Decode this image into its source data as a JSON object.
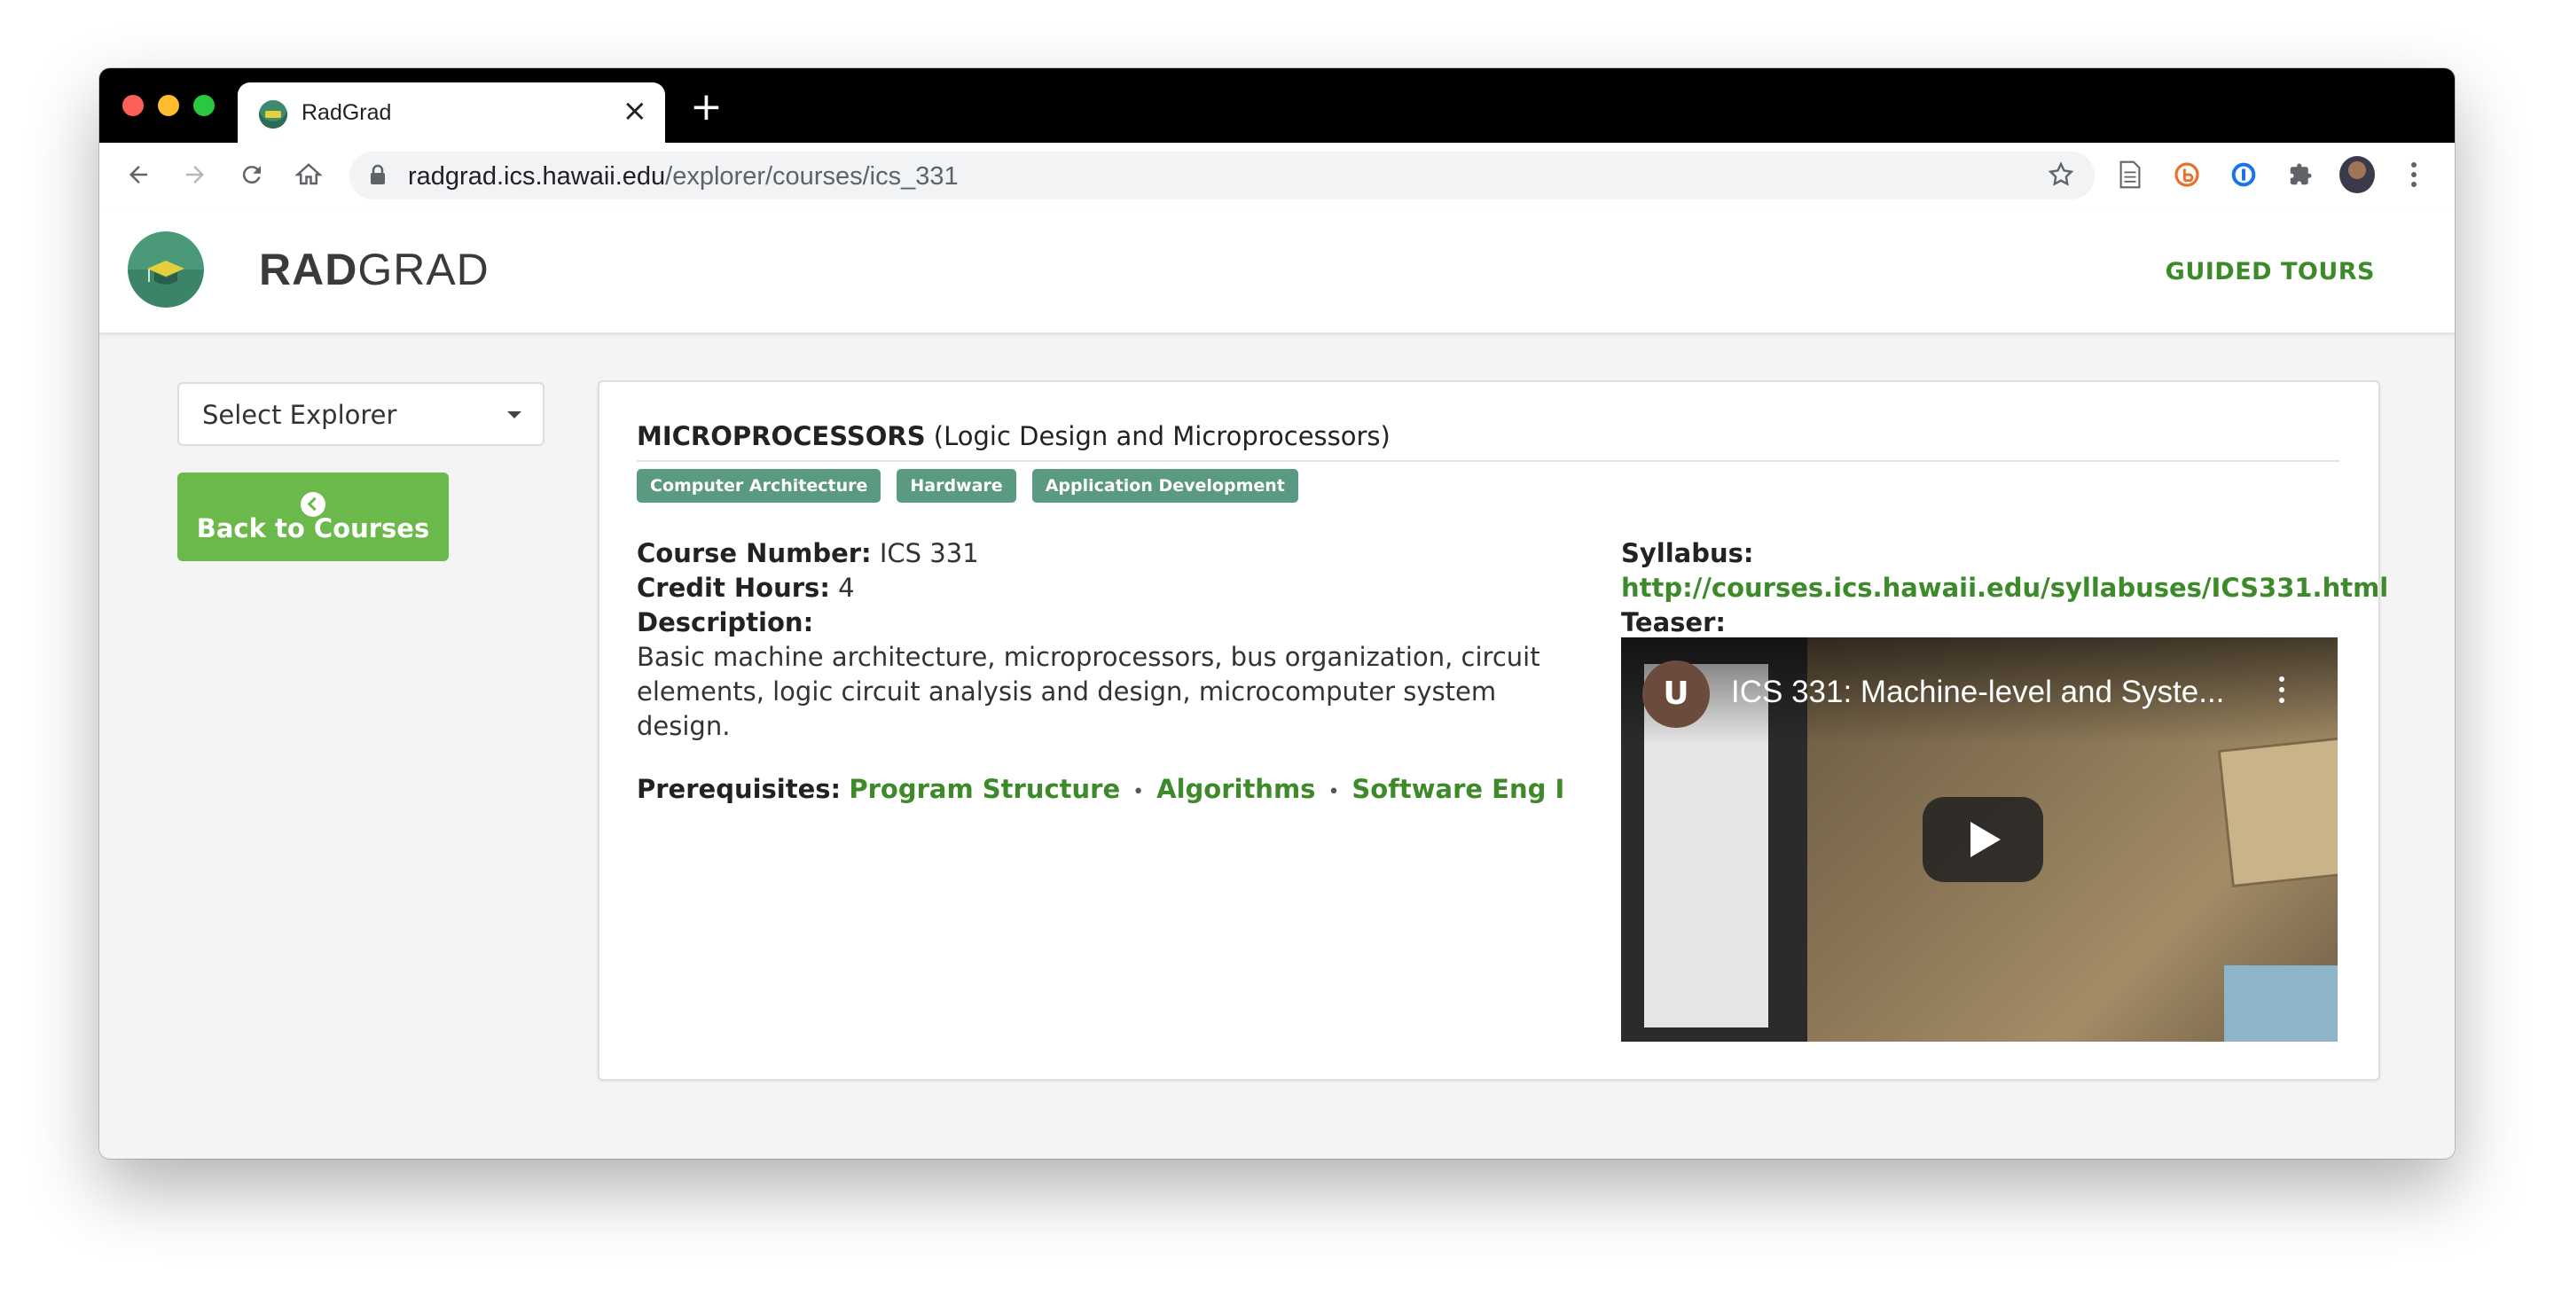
{
  "browser": {
    "tab_title": "RadGrad",
    "tab_close": "×",
    "new_tab": "+",
    "url_host": "radgrad.ics.hawaii.edu",
    "url_path": "/explorer/courses/ics_331"
  },
  "header": {
    "brand_bold": "RAD",
    "brand_light": "GRAD",
    "guided_tours": "GUIDED TOURS"
  },
  "sidebar": {
    "select_label": "Select Explorer",
    "back_button": "Back to Courses"
  },
  "course": {
    "title_main": "MICROPROCESSORS",
    "title_sub": " (Logic Design and Microprocessors)",
    "tags": [
      "Computer Architecture",
      "Hardware",
      "Application Development"
    ],
    "course_number_label": "Course Number:",
    "course_number": "ICS 331",
    "credit_hours_label": "Credit Hours:",
    "credit_hours": "4",
    "description_label": "Description:",
    "description": "Basic machine architecture, microprocessors, bus organization, circuit elements, logic circuit analysis and design, microcomputer system design.",
    "prerequisites_label": "Prerequisites:",
    "prerequisites": [
      "Program Structure",
      "Algorithms",
      "Software Eng I"
    ],
    "prereq_separator": "•",
    "syllabus_label": "Syllabus:",
    "syllabus_url": "http://courses.ics.hawaii.edu/syllabuses/ICS331.html",
    "teaser_label": "Teaser:",
    "video": {
      "channel_initial": "U",
      "title": "ICS 331: Machine-level and Syste..."
    }
  }
}
